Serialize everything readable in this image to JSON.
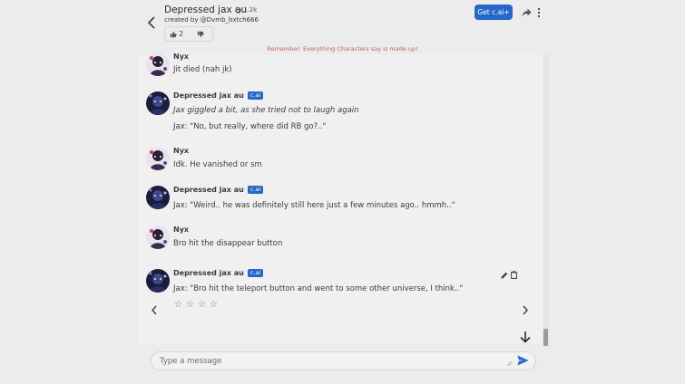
{
  "header": {
    "character_name": "Depressed jax au",
    "interaction_count": "1.2k",
    "creator_prefix": "created by",
    "creator_handle": "@Dvmb_bxtch666",
    "like_count": "2",
    "cta_label": "Get c.ai+"
  },
  "disclaimer": "Remember: Everything Characters say is made up!",
  "badge_label": "c.ai",
  "messages": [
    {
      "author": "Nyx",
      "is_bot": false,
      "lines": [
        "Jit died (nah jk)"
      ]
    },
    {
      "author": "Depressed jax au",
      "is_bot": true,
      "lines": [
        "Jax giggled a bit, as she tried not to laugh again",
        "Jax: \"No, but really, where did RB go?..\""
      ]
    },
    {
      "author": "Nyx",
      "is_bot": false,
      "lines": [
        "Idk. He vanished or sm"
      ]
    },
    {
      "author": "Depressed jax au",
      "is_bot": true,
      "lines": [
        "Jax: \"Weird.. he was definitely still here just a few minutes ago.. hmmh..\""
      ]
    },
    {
      "author": "Nyx",
      "is_bot": false,
      "lines": [
        "Bro hit the disappear button"
      ]
    },
    {
      "author": "Depressed jax au",
      "is_bot": true,
      "lines": [
        "Jax: \"Bro hit the teleport button and went to some other universe, I think..\""
      ]
    }
  ],
  "rating": {
    "stars": [
      "☆",
      "☆",
      "☆",
      "☆"
    ]
  },
  "composer": {
    "placeholder": "Type a message",
    "value": ""
  },
  "colors": {
    "accent": "#2667c7",
    "disclaimer": "#c65f55",
    "background": "#ececed"
  },
  "icons": {
    "back": "chevron-left-icon",
    "interactions": "chat-bubble-icon",
    "like": "thumbs-up-icon",
    "dislike": "thumbs-down-icon",
    "share": "share-icon",
    "more": "more-vertical-icon",
    "edit": "pencil-icon",
    "copy": "copy-icon",
    "prev": "chevron-left-icon",
    "next": "chevron-right-icon",
    "scroll_down": "arrow-down-icon",
    "send": "send-icon"
  }
}
